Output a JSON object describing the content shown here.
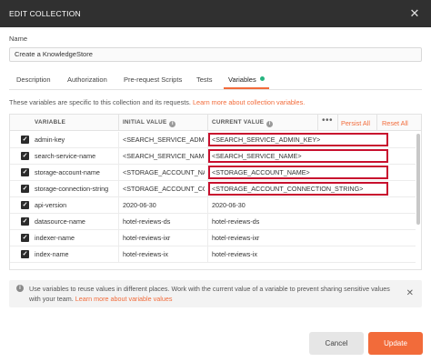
{
  "dialog": {
    "title": "EDIT COLLECTION",
    "close_glyph": "✕"
  },
  "name_field": {
    "label": "Name",
    "value": "Create a KnowledgeStore"
  },
  "tabs": [
    {
      "label": "Description"
    },
    {
      "label": "Authorization"
    },
    {
      "label": "Pre-request Scripts"
    },
    {
      "label": "Tests"
    },
    {
      "label": "Variables",
      "active": true,
      "indicator_color": "#26b47f"
    }
  ],
  "intro": {
    "text": "These variables are specific to this collection and its requests. ",
    "link": "Learn more about collection variables."
  },
  "table": {
    "headers": {
      "variable": "VARIABLE",
      "initial": "INITIAL VALUE",
      "current": "CURRENT VALUE",
      "more": "•••",
      "persist_all": "Persist All",
      "reset_all": "Reset All"
    },
    "rows": [
      {
        "checked": true,
        "variable": "admin-key",
        "initial": "<SEARCH_SERVICE_ADMIN_KEY>",
        "current": "<SEARCH_SERVICE_ADMIN_KEY>",
        "highlighted": true
      },
      {
        "checked": true,
        "variable": "search-service-name",
        "initial": "<SEARCH_SERVICE_NAME>",
        "current": "<SEARCH_SERVICE_NAME>",
        "highlighted": true
      },
      {
        "checked": true,
        "variable": "storage-account-name",
        "initial": "<STORAGE_ACCOUNT_NAME>",
        "current": "<STORAGE_ACCOUNT_NAME>",
        "highlighted": true
      },
      {
        "checked": true,
        "variable": "storage-connection-string",
        "initial": "<STORAGE_ACCOUNT_CONNECTION_STRING>",
        "current": "<STORAGE_ACCOUNT_CONNECTION_STRING>",
        "highlighted": true
      },
      {
        "checked": true,
        "variable": "api-version",
        "initial": "2020-06-30",
        "current": "2020-06-30",
        "highlighted": false
      },
      {
        "checked": true,
        "variable": "datasource-name",
        "initial": "hotel-reviews-ds",
        "current": "hotel-reviews-ds",
        "highlighted": false
      },
      {
        "checked": true,
        "variable": "indexer-name",
        "initial": "hotel-reviews-ixr",
        "current": "hotel-reviews-ixr",
        "highlighted": false
      },
      {
        "checked": true,
        "variable": "index-name",
        "initial": "hotel-reviews-ix",
        "current": "hotel-reviews-ix",
        "highlighted": false
      }
    ]
  },
  "info": {
    "text": "Use variables to reuse values in different places. Work with the current value of a variable to prevent sharing sensitive values with your team. ",
    "link": "Learn more about variable values",
    "close_glyph": "✕"
  },
  "buttons": {
    "cancel": "Cancel",
    "update": "Update"
  },
  "colors": {
    "accent": "#f26b3a",
    "titlebar": "#303030",
    "highlight_border": "#c8102e"
  }
}
